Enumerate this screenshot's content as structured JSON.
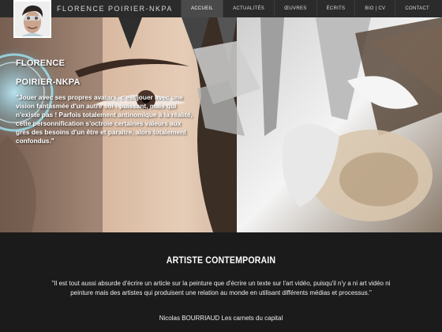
{
  "header": {
    "site_name": "FLORENCE POIRIER-NKPA",
    "nav": [
      {
        "label": "ACCUEIL",
        "active": true
      },
      {
        "label": "ACTUALITÉS",
        "active": false
      },
      {
        "label": "ŒUVRES",
        "active": false
      },
      {
        "label": "ÉCRITS",
        "active": false
      },
      {
        "label": "BIO | CV",
        "active": false
      },
      {
        "label": "CONTACT",
        "active": false
      }
    ]
  },
  "hero": {
    "artist_first": "FLORENCE",
    "artist_last": "POIRIER-NKPA",
    "quote": "\"Jouer avec ses propres avatars, c'est jouer avec une vision fantasmée d'un autre soi : puissant, mais qui n'existe pas ! Parfois totalement antinomique à la réalité, cette personnification s'octroie certaines valeurs aux grès des besoins d'un être et paraître, alors totalement confondus.\""
  },
  "section": {
    "title": "ARTISTE CONTEMPORAIN",
    "citation": "\"Il est tout aussi absurde d'écrire un article sur la peinture que d'écrire un texte sur l'art vidéo, puisqu'il n'y a ni art vidéo ni peinture mais des artistes qui produisent une relation au monde en utilisant différents médias et processus.\"",
    "citation_author": "Nicolas BOURRIAUD Les carnets du capital"
  }
}
